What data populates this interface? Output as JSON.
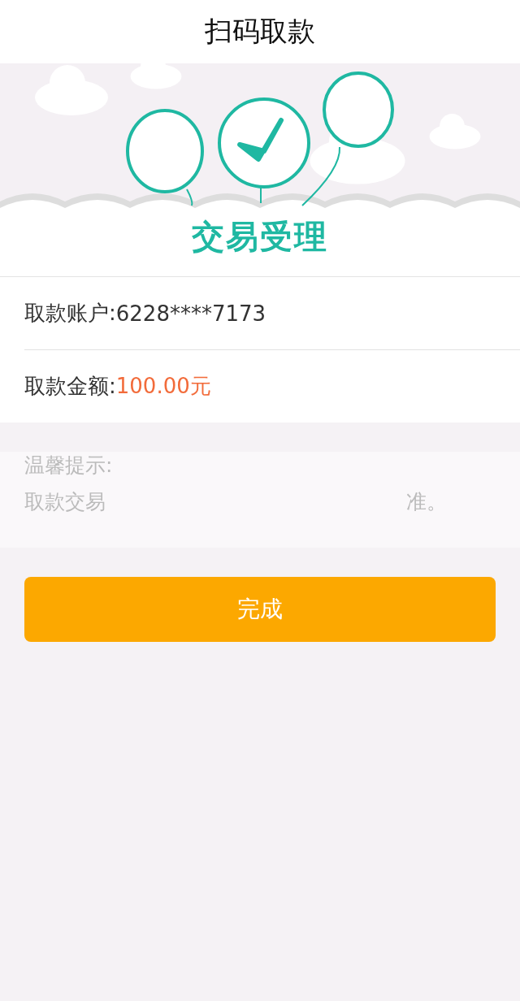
{
  "header": {
    "title": "扫码取款"
  },
  "banner": {
    "caption": "交易受理"
  },
  "details": [
    {
      "label": "取款账户:",
      "value": "6228****7173",
      "kind": "plain"
    },
    {
      "label": "取款金额:",
      "value": "100.00元",
      "kind": "amount"
    }
  ],
  "tips": {
    "heading": "温馨提示:",
    "line_start": "取款交易",
    "line_end": "准。"
  },
  "done_button": {
    "label": "完成"
  }
}
